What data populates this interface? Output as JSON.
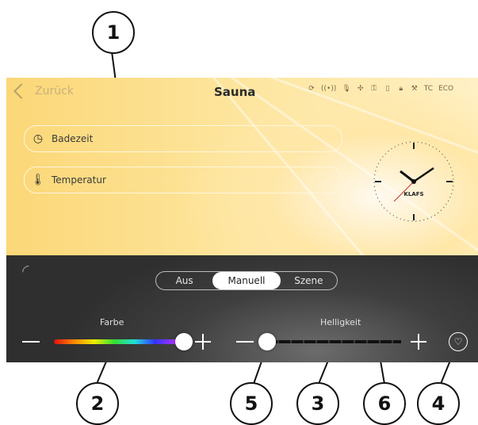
{
  "header": {
    "back_label": "Zurück",
    "title": "Sauna",
    "status_icons": [
      "sync-icon",
      "wifi-icon",
      "microphone-icon",
      "fan-icon",
      "key-icon",
      "phone-icon",
      "lock-icon",
      "wrench-icon"
    ],
    "tc": "TC",
    "eco": "ECO"
  },
  "fields": {
    "badezeit": "Badezeit",
    "temperatur": "Temperatur"
  },
  "clock": {
    "brand": "KLAFS",
    "time": "10:08"
  },
  "mode": {
    "options": [
      "Aus",
      "Manuell",
      "Szene"
    ],
    "selected": "Manuell"
  },
  "color_slider": {
    "label": "Farbe",
    "value": 1.0
  },
  "brightness_slider": {
    "label": "Helligkeit",
    "value": 0.0
  },
  "callouts": [
    "1",
    "2",
    "3",
    "4",
    "5",
    "6"
  ]
}
